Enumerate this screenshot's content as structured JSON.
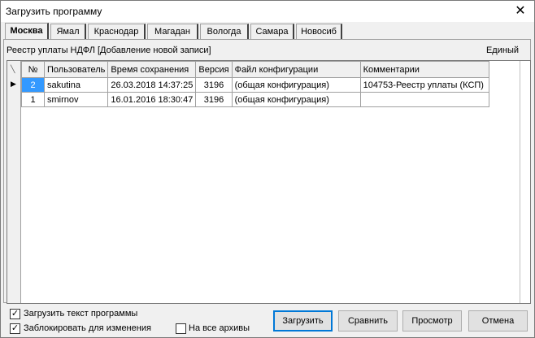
{
  "window": {
    "title": "Загрузить программу",
    "close_glyph": "✕"
  },
  "tabs": [
    "Москва",
    "Ямал",
    "Краснодар",
    "Магадан",
    "Вологда",
    "Самара",
    "Новосиб"
  ],
  "document": {
    "name": "Реестр уплаты НДФЛ [Добавление новой записи]",
    "scope": "Единый"
  },
  "grid": {
    "columns": [
      "№",
      "Пользователь",
      "Время сохранения",
      "Версия",
      "Файл конфигурации",
      "Комментарии"
    ],
    "rows": [
      {
        "num": "2",
        "user": "sakutina",
        "time": "26.03.2018 14:37:25",
        "version": "3196",
        "config": "(общая конфигурация)",
        "comment": "104753-Реестр уплаты (КСП)"
      },
      {
        "num": "1",
        "user": "smirnov",
        "time": "16.01.2016 18:30:47",
        "version": "3196",
        "config": "(общая конфигурация)",
        "comment": ""
      }
    ]
  },
  "options": {
    "load_text": {
      "label": "Загрузить текст программы",
      "checked": true
    },
    "lock": {
      "label": "Заблокировать для изменения",
      "checked": true
    },
    "all_archives": {
      "label": "На все архивы",
      "checked": false
    }
  },
  "buttons": {
    "load": "Загрузить",
    "compare": "Сравнить",
    "preview": "Просмотр",
    "cancel": "Отмена"
  },
  "colors": {
    "selection": "#3399ff",
    "default_button_border": "#0078d7"
  }
}
